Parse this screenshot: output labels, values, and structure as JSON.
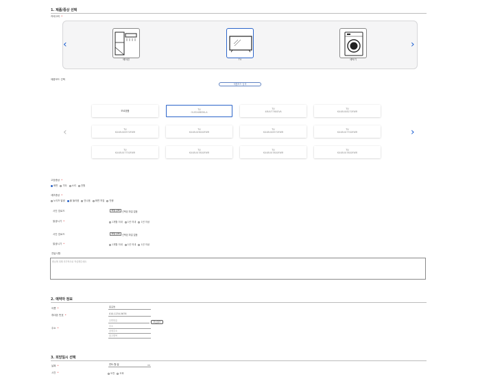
{
  "section1": {
    "title": "1. 제품/증상 선택",
    "category_label": "카테고리",
    "categories": [
      {
        "label": "에어컨",
        "icon": "aircon-fridge-icon"
      },
      {
        "label": "TV",
        "icon": "tv-icon"
      },
      {
        "label": "세탁기",
        "icon": "washer-icon"
      }
    ],
    "model_label": "제품모드 선택",
    "model_search": "제품모드 검색",
    "models": [
      {
        "line1": "모르겠음",
        "line2": ""
      },
      {
        "line1": "TV",
        "line2": "OLED48B3KLA"
      },
      {
        "line1": "TV",
        "line2": "48UU7760GVA"
      },
      {
        "line1": "TV",
        "line2": "KU48UU8270FWR"
      },
      {
        "line1": "TV",
        "line2": "KU48UU8370FWR"
      },
      {
        "line1": "TV",
        "line2": "KU48UU9000FWR"
      },
      {
        "line1": "TV",
        "line2": "KU48UU8370FWR"
      },
      {
        "line1": "TV",
        "line2": "KU48UU7700FWR"
      },
      {
        "line1": "TV",
        "line2": "KU48UU7750FWR"
      },
      {
        "line1": "TV",
        "line2": "KU48UU7800FWR"
      },
      {
        "line1": "TV",
        "line2": "KU48UU7800FWR"
      },
      {
        "line1": "TV",
        "line2": "KU48UU7800FWR"
      }
    ],
    "fault_type_label": "고장증상",
    "fault_types": [
      "화면",
      "기타",
      "소리",
      "전원"
    ],
    "symptom_label": "세부증상",
    "symptoms": [
      "노이즈 발생",
      "불 들어옴",
      "안나옴",
      "화면 꺼짐",
      "반응"
    ],
    "photo_label": "사진 업로드",
    "file_button": "파일 선택",
    "file_status": "선택된 파일 없음",
    "timing_label": "발생시기",
    "timing_options": [
      "1개월 이내",
      "1년 이내",
      "1년 이상"
    ],
    "notes_label": "전달사항",
    "notes_placeholder": "증상에 대해 추가적으로 작성해주세요."
  },
  "section2": {
    "title": "2. 예약자 정보",
    "name_label": "이름",
    "name_value": "홍길동",
    "phone_label": "휴대폰 번호",
    "phone_value": "010-1234-5678",
    "address_label": "주소",
    "zip_placeholder": "우편번호",
    "zip_button": "주소찾기",
    "addr1_placeholder": "주소",
    "addr2_placeholder": "상세주소",
    "addr3_placeholder": "참고항목"
  },
  "section3": {
    "title": "3. 희망일시 선택",
    "date_label": "날짜",
    "date_value": "연도-월-일",
    "time_label": "시간",
    "time_options": [
      "오전",
      "오후"
    ]
  },
  "colors": {
    "accent": "#2a63c9",
    "required": "#dd3333"
  }
}
